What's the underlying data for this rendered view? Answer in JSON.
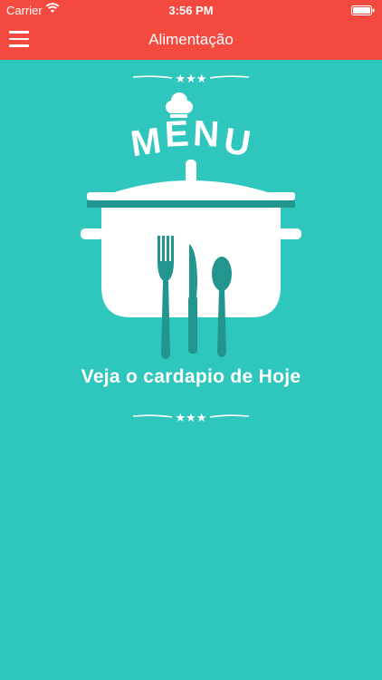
{
  "status_bar": {
    "carrier": "Carrier",
    "time": "3:56 PM"
  },
  "nav": {
    "title": "Alimentação",
    "menu_icon": "hamburger-menu-icon"
  },
  "emblem": {
    "heading": "MENU",
    "tagline": "Veja o cardapio de Hoje"
  },
  "colors": {
    "header": "#f4493f",
    "background": "#2ec6bd",
    "accent_dark": "#22958e",
    "text": "#ffffff"
  }
}
